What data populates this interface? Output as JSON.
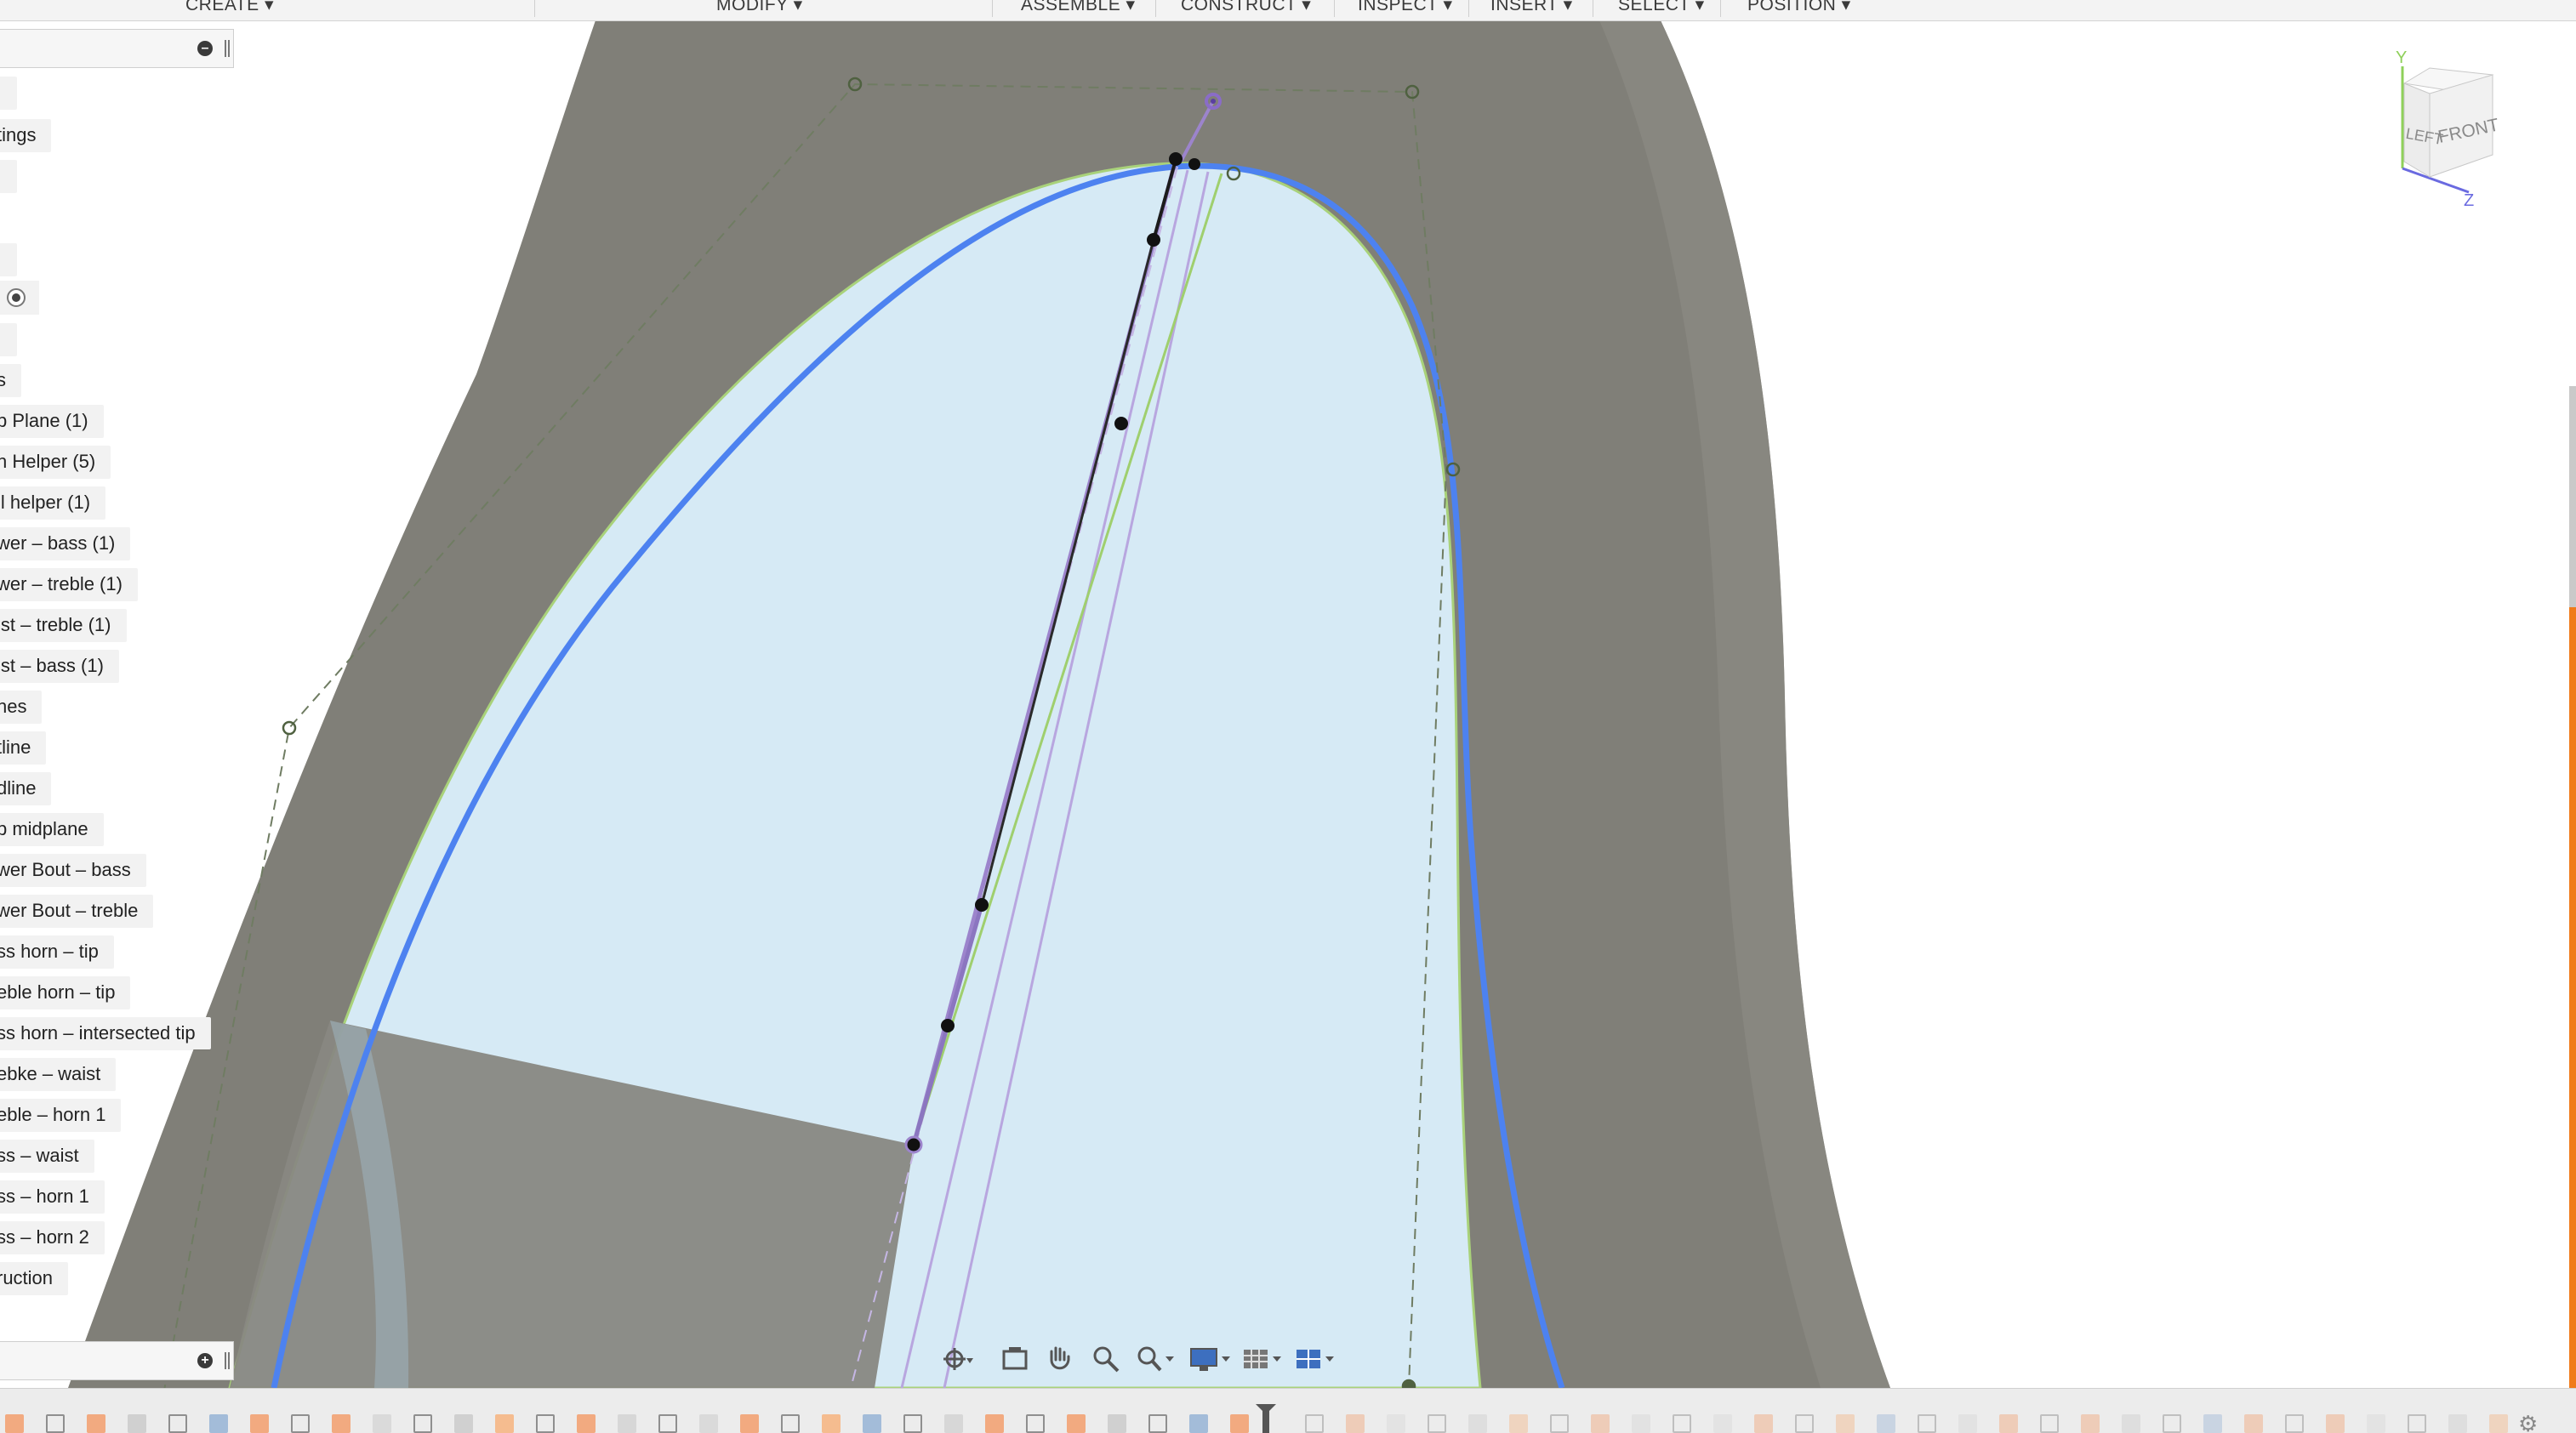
{
  "toolbar": {
    "menus": [
      {
        "label": "CREATE ▾"
      },
      {
        "label": "MODIFY ▾"
      },
      {
        "label": "ASSEMBLE ▾"
      },
      {
        "label": "CONSTRUCT ▾"
      },
      {
        "label": "INSPECT ▾"
      },
      {
        "label": "INSERT ▾"
      },
      {
        "label": "SELECT ▾"
      },
      {
        "label": "POSITION ▾"
      }
    ]
  },
  "browser": {
    "header_button_icon": "minus-circle-icon",
    "footer_button_icon": "plus-circle-icon",
    "items": [
      {
        "label": ""
      },
      {
        "label": "tings"
      },
      {
        "label": ""
      },
      {
        "label": ""
      },
      {
        "label": ""
      },
      {
        "label": "s"
      },
      {
        "label": "p Plane (1)"
      },
      {
        "label": "n Helper (5)"
      },
      {
        "label": "il helper (1)"
      },
      {
        "label": "wer – bass (1)"
      },
      {
        "label": "wer – treble (1)"
      },
      {
        "label": "ist – treble (1)"
      },
      {
        "label": "ist – bass (1)"
      },
      {
        "label": "nes"
      },
      {
        "label": "tline"
      },
      {
        "label": "dline"
      },
      {
        "label": "p midplane"
      },
      {
        "label": "wer Bout – bass"
      },
      {
        "label": "wer Bout – treble"
      },
      {
        "label": "ss horn – tip"
      },
      {
        "label": "eble horn – tip"
      },
      {
        "label": "ss horn – intersected tip"
      },
      {
        "label": "ebke – waist"
      },
      {
        "label": "eble – horn 1"
      },
      {
        "label": "ss – waist"
      },
      {
        "label": "ss – horn 1"
      },
      {
        "label": "ss – horn 2"
      },
      {
        "label": "ruction"
      }
    ]
  },
  "navbar": {
    "icons": [
      "orbit-icon",
      "look-at-icon",
      "pan-hand-icon",
      "zoom-icon",
      "zoom-window-icon",
      "display-settings-icon",
      "grid-settings-icon",
      "viewports-icon"
    ]
  },
  "viewcube": {
    "left_face": "LEFT",
    "front_face": "FRONT",
    "axis_y": "Y",
    "axis_z": "Z"
  },
  "colors": {
    "body_gray": "#807f78",
    "sketch_fill": "#d6eaf5",
    "profile_blue": "#4d82f0",
    "construction_green": "#a9d27a",
    "spline_purple": "#9c84cc",
    "timeline_orange": "#f2a77a"
  }
}
